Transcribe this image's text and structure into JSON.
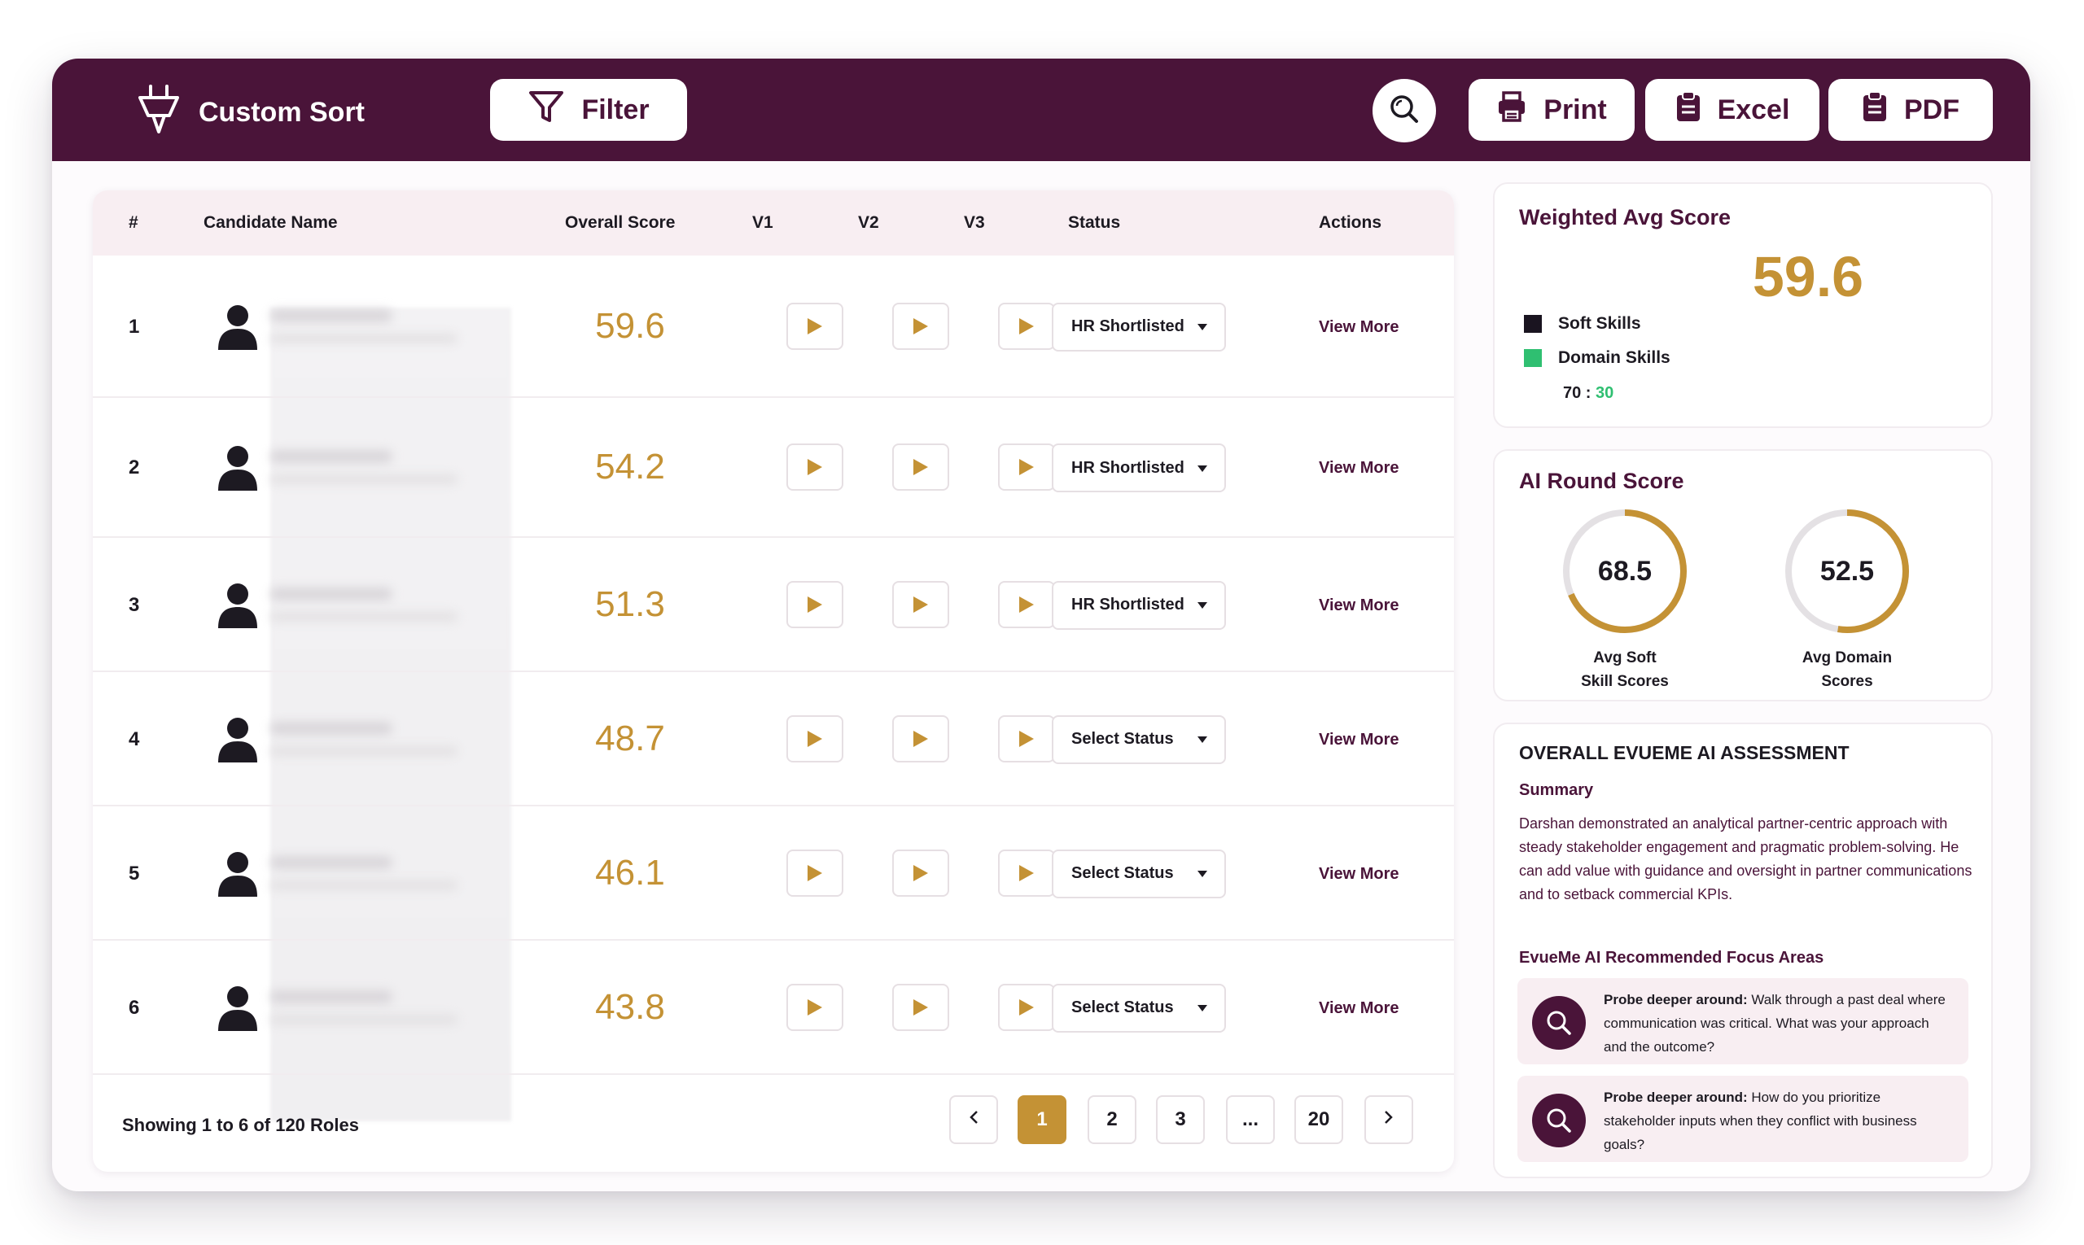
{
  "header": {
    "custom_sort_label": "Custom Sort",
    "filter_label": "Filter",
    "print_label": "Print",
    "excel_label": "Excel",
    "pdf_label": "PDF"
  },
  "table": {
    "columns": [
      "#",
      "Candidate Name",
      "Overall Score",
      "V1",
      "V2",
      "V3",
      "Status",
      "Actions"
    ],
    "rows": [
      {
        "index": "1",
        "score": "59.6",
        "status": "HR Shortlisted",
        "action": "View More"
      },
      {
        "index": "2",
        "score": "54.2",
        "status": "HR Shortlisted",
        "action": "View More"
      },
      {
        "index": "3",
        "score": "51.3",
        "status": "HR Shortlisted",
        "action": "View More"
      },
      {
        "index": "4",
        "score": "48.7",
        "status": "Select Status",
        "action": "View More"
      },
      {
        "index": "5",
        "score": "46.1",
        "status": "Select Status",
        "action": "View More"
      },
      {
        "index": "6",
        "score": "43.8",
        "status": "Select Status",
        "action": "View More"
      }
    ],
    "footer_text": "Showing 1 to 6 of 120 Roles",
    "pages": [
      "1",
      "2",
      "3",
      "...",
      "20"
    ],
    "active_page": "1"
  },
  "weighted": {
    "title": "Weighted Avg Score",
    "score": "59.6",
    "legend": [
      {
        "label": "Soft Skills",
        "color": "#1a1420"
      },
      {
        "label": "Domain Skills",
        "color": "#2fbf71"
      }
    ],
    "ratio_left": "70 : ",
    "ratio_right": "30"
  },
  "ai_round": {
    "title": "AI Round Score",
    "gauges": [
      {
        "value": "68.5",
        "label_line1": "Avg Soft",
        "label_line2": "Skill Scores",
        "fraction": 0.685
      },
      {
        "value": "52.5",
        "label_line1": "Avg Domain",
        "label_line2": "Scores",
        "fraction": 0.525
      }
    ]
  },
  "assessment": {
    "title": "OVERALL EVUEME AI ASSESSMENT",
    "summary_heading": "Summary",
    "summary_text": "Darshan demonstrated an analytical partner-centric approach with steady stakeholder engagement and pragmatic problem-solving. He can add value with guidance and oversight in partner communications and to setback commercial KPIs.",
    "focus_heading": "EvueMe AI Recommended Focus Areas",
    "focus_items": [
      {
        "lead": "Probe deeper around:",
        "text": " Walk through a past deal where communication was critical. What was your approach and the outcome?"
      },
      {
        "lead": "Probe deeper around:",
        "text": " How do you prioritize stakeholder inputs when they conflict with business goals?"
      }
    ]
  },
  "colors": {
    "brand": "#4a1439",
    "accent": "#c49235",
    "green": "#2fbf71"
  }
}
